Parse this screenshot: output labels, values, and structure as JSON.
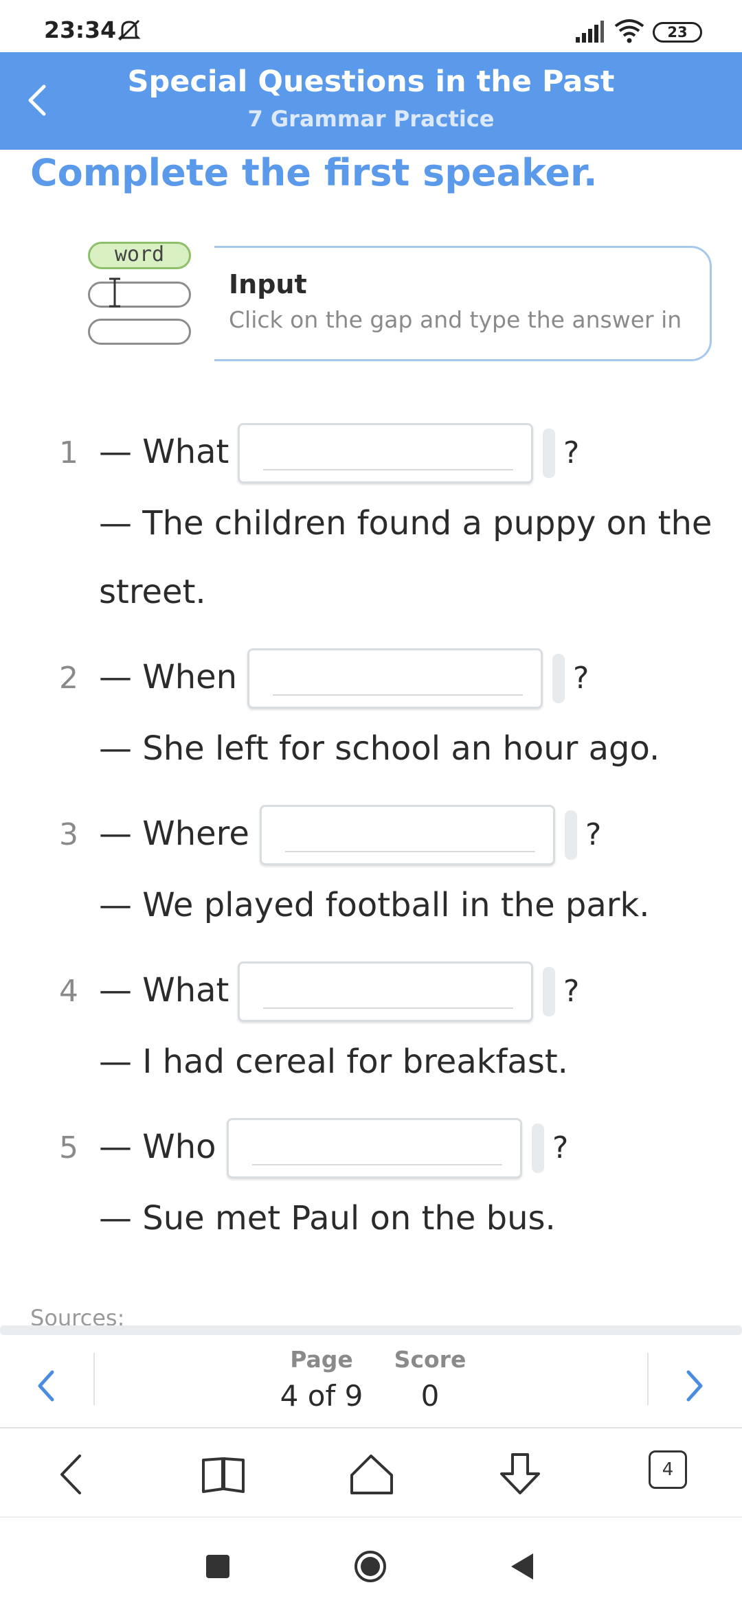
{
  "status_bar": {
    "time": "23:34",
    "battery": "23"
  },
  "header": {
    "title": "Special Questions in the Past",
    "subtitle": "7 Grammar Practice",
    "background_color": "#5b9aea"
  },
  "task": {
    "heading": "Complete the first speaker.",
    "hint": {
      "illustration_word": "word",
      "title": "Input",
      "description": "Click on the gap and type the answer in"
    }
  },
  "questions": [
    {
      "number": "1",
      "prefix": "— What",
      "suffix": "?",
      "answer": "— The children found a puppy on the",
      "answer_cont": "street."
    },
    {
      "number": "2",
      "prefix": "— When",
      "suffix": "?",
      "answer": "— She left for school an hour ago."
    },
    {
      "number": "3",
      "prefix": "— Where",
      "suffix": "?",
      "answer": "— We played football in the park."
    },
    {
      "number": "4",
      "prefix": "— What",
      "suffix": "?",
      "answer": "— I had cereal for breakfast."
    },
    {
      "number": "5",
      "prefix": "— Who",
      "suffix": "?",
      "answer": "— Sue met Paul on the bus."
    }
  ],
  "sources_label": "Sources:",
  "pager": {
    "page_label": "Page",
    "page_value": "4 of 9",
    "score_label": "Score",
    "score_value": "0"
  },
  "browser": {
    "tabs_count": "4"
  },
  "icons": {
    "back": "chevron-left-icon",
    "prev": "chevron-left-icon",
    "next": "chevron-right-icon",
    "book": "book-icon",
    "home": "home-icon",
    "download": "download-icon"
  }
}
